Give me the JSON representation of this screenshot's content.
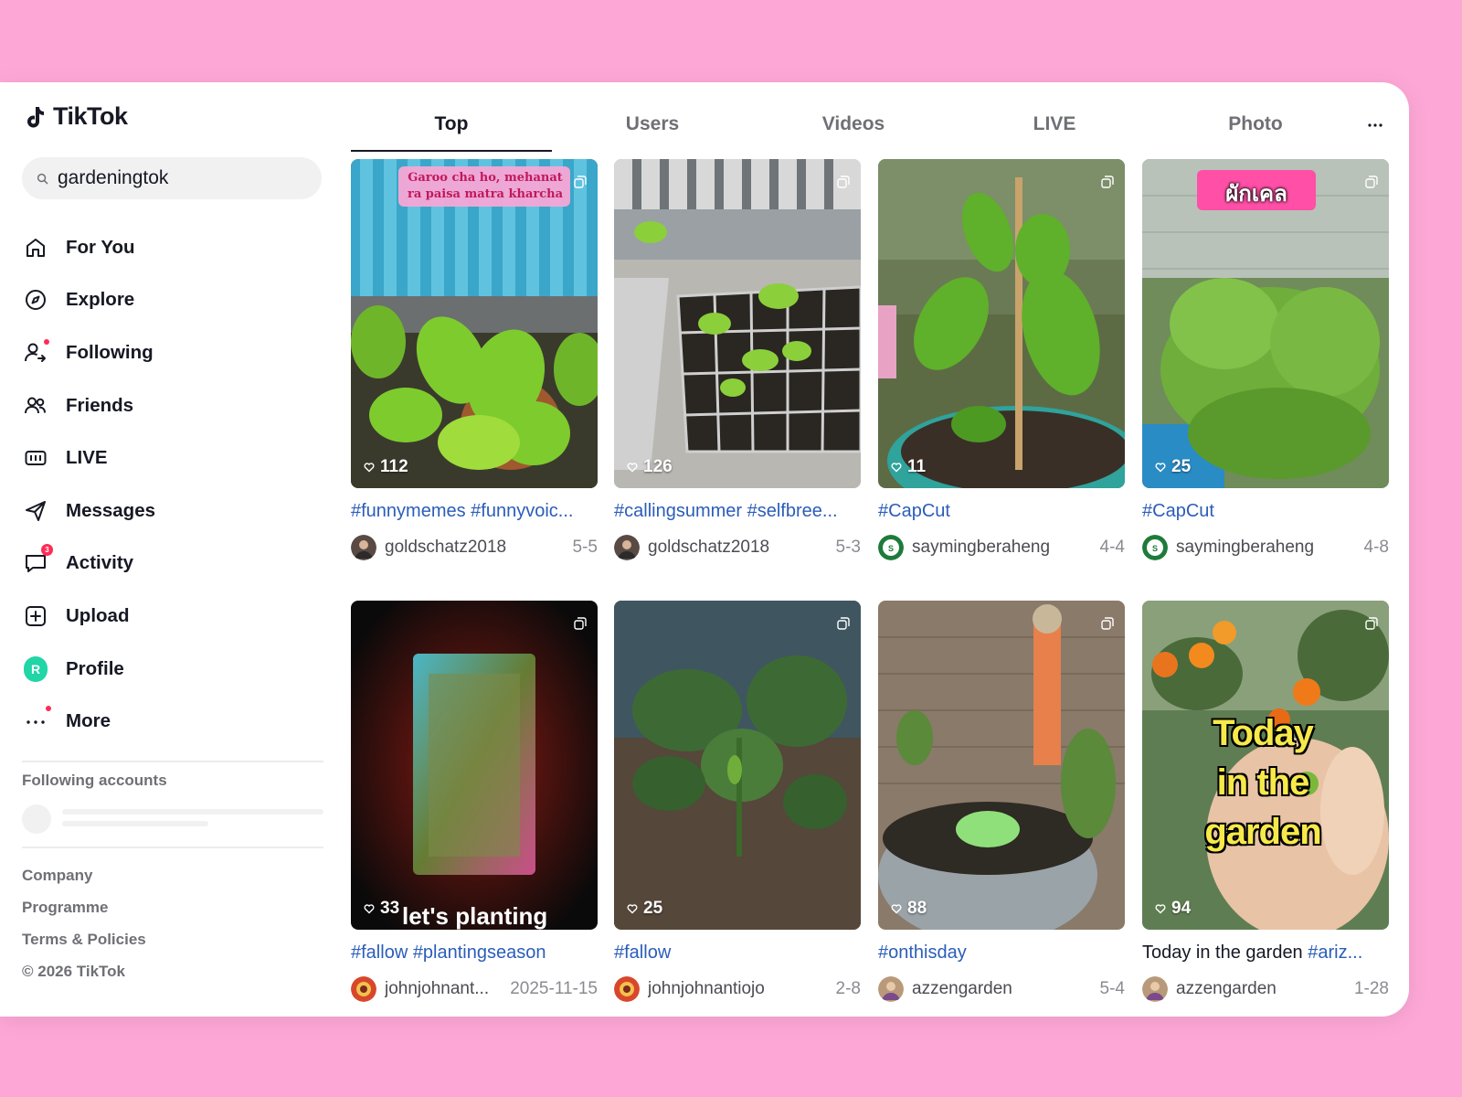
{
  "app": {
    "name": "TikTok"
  },
  "search": {
    "query": "gardeningtok"
  },
  "nav": {
    "items": [
      {
        "label": "For You"
      },
      {
        "label": "Explore"
      },
      {
        "label": "Following"
      },
      {
        "label": "Friends"
      },
      {
        "label": "LIVE"
      },
      {
        "label": "Messages"
      },
      {
        "label": "Activity",
        "badge": "3"
      },
      {
        "label": "Upload"
      },
      {
        "label": "Profile",
        "avatar_letter": "R"
      },
      {
        "label": "More"
      }
    ]
  },
  "following_accounts": {
    "title": "Following accounts"
  },
  "footer": {
    "links": [
      "Company",
      "Programme",
      "Terms & Policies",
      "© 2026 TikTok"
    ]
  },
  "tabs": [
    {
      "label": "Top",
      "active": true
    },
    {
      "label": "Users"
    },
    {
      "label": "Videos"
    },
    {
      "label": "LIVE"
    },
    {
      "label": "Photo"
    }
  ],
  "results": [
    {
      "likes": "112",
      "caption": "#funnymemes #funnyvoic...",
      "user": "goldschatz2018",
      "date": "5-5",
      "overlay": "Garoo cha ho, mehanat ra paisa matra kharcha"
    },
    {
      "likes": "126",
      "caption": "#callingsummer #selfbree...",
      "user": "goldschatz2018",
      "date": "5-3"
    },
    {
      "likes": "11",
      "caption": "#CapCut",
      "user": "saymingberaheng",
      "date": "4-4"
    },
    {
      "likes": "25",
      "caption": "#CapCut",
      "user": "saymingberaheng",
      "date": "4-8",
      "overlay": "ผักเคล"
    },
    {
      "likes": "33",
      "caption": "#fallow #plantingseason",
      "user": "johnjohnant...",
      "date": "2025-11-15",
      "overlay": "let's planting"
    },
    {
      "likes": "25",
      "caption": "#fallow",
      "user": "johnjohnantiojo",
      "date": "2-8"
    },
    {
      "likes": "88",
      "caption": "#onthisday",
      "user": "azzengarden",
      "date": "5-4"
    },
    {
      "likes": "94",
      "caption_plain": "Today in the garden ",
      "caption": "#ariz...",
      "user": "azzengarden",
      "date": "1-28",
      "overlay_lines": [
        "Today",
        "in the",
        "garden"
      ]
    }
  ],
  "colors": {
    "accent": "#fe2c55",
    "hashtag": "#2b5db9",
    "background": "#fda7d6"
  }
}
